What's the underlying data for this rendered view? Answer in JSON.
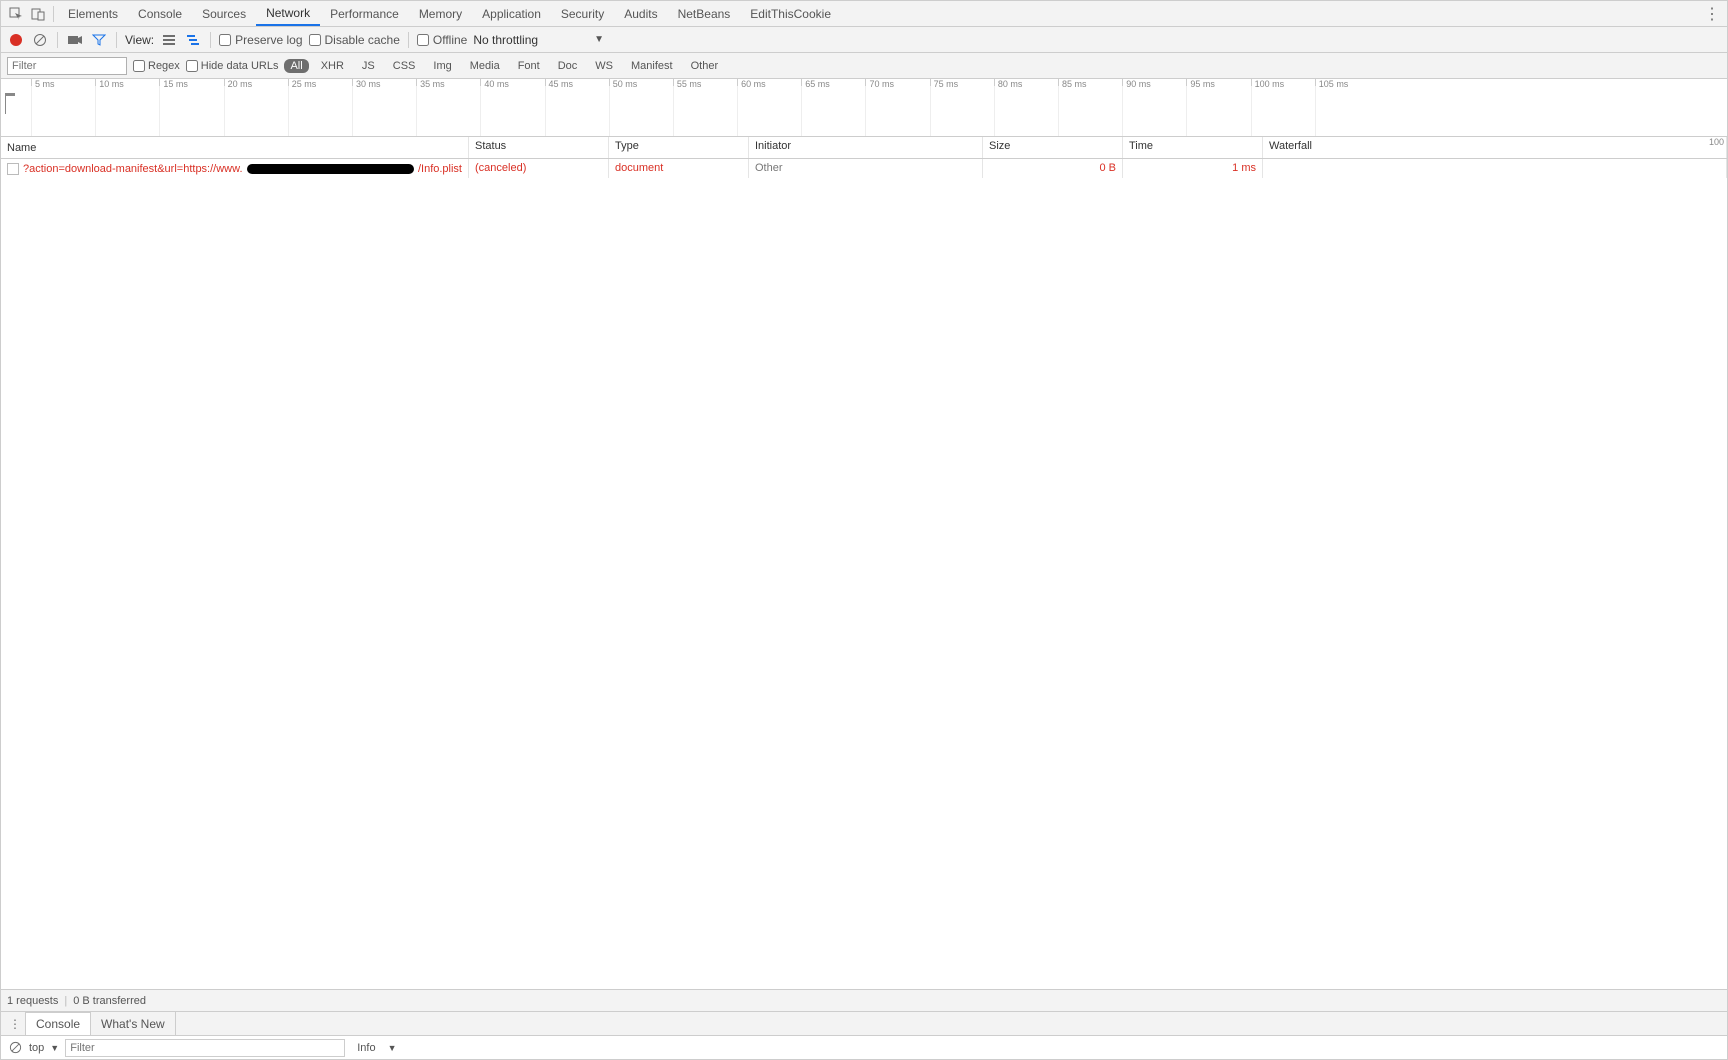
{
  "tabs": [
    "Elements",
    "Console",
    "Sources",
    "Network",
    "Performance",
    "Memory",
    "Application",
    "Security",
    "Audits",
    "NetBeans",
    "EditThisCookie"
  ],
  "activeTab": "Network",
  "toolbar": {
    "view_label": "View:",
    "preserve_log": "Preserve log",
    "disable_cache": "Disable cache",
    "offline": "Offline",
    "throttling": "No throttling"
  },
  "filter": {
    "placeholder": "Filter",
    "regex": "Regex",
    "hide_data_urls": "Hide data URLs",
    "types": [
      "All",
      "XHR",
      "JS",
      "CSS",
      "Img",
      "Media",
      "Font",
      "Doc",
      "WS",
      "Manifest",
      "Other"
    ],
    "active_type": "All"
  },
  "timeline": {
    "ticks": [
      "5 ms",
      "10 ms",
      "15 ms",
      "20 ms",
      "25 ms",
      "30 ms",
      "35 ms",
      "40 ms",
      "45 ms",
      "50 ms",
      "55 ms",
      "60 ms",
      "65 ms",
      "70 ms",
      "75 ms",
      "80 ms",
      "85 ms",
      "90 ms",
      "95 ms",
      "100 ms",
      "105 ms"
    ],
    "right_label": "100"
  },
  "columns": {
    "name": "Name",
    "status": "Status",
    "type": "Type",
    "initiator": "Initiator",
    "size": "Size",
    "time": "Time",
    "waterfall": "Waterfall"
  },
  "rows": [
    {
      "name_prefix": "?action=download-manifest&url=https://www.",
      "name_suffix": "/Info.plist",
      "status": "(canceled)",
      "type": "document",
      "initiator": "Other",
      "size": "0 B",
      "time": "1 ms"
    }
  ],
  "status": {
    "requests": "1 requests",
    "transferred": "0 B transferred"
  },
  "drawer": {
    "tabs": [
      "Console",
      "What's New"
    ]
  },
  "console": {
    "context": "top",
    "filter_placeholder": "Filter",
    "level": "Info"
  }
}
